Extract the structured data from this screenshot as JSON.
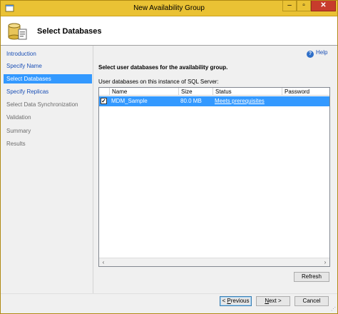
{
  "window": {
    "title": "New Availability Group",
    "min_glyph": "–",
    "max_glyph": "▫",
    "close_glyph": "✕"
  },
  "header": {
    "title": "Select Databases"
  },
  "nav": {
    "items": [
      {
        "label": "Introduction",
        "state": "link"
      },
      {
        "label": "Specify Name",
        "state": "link"
      },
      {
        "label": "Select Databases",
        "state": "active"
      },
      {
        "label": "Specify Replicas",
        "state": "link"
      },
      {
        "label": "Select Data Synchronization",
        "state": "dim"
      },
      {
        "label": "Validation",
        "state": "dim"
      },
      {
        "label": "Summary",
        "state": "dim"
      },
      {
        "label": "Results",
        "state": "dim"
      }
    ]
  },
  "main": {
    "help_label": "Help",
    "instruction": "Select user databases for the availability group.",
    "grid_label": "User databases on this instance of SQL Server:",
    "columns": [
      "Name",
      "Size",
      "Status",
      "Password"
    ],
    "rows": [
      {
        "checked": true,
        "name": "MDM_Sample",
        "size": "80.0 MB",
        "status": "Meets prerequisites",
        "password": ""
      }
    ],
    "refresh_label": "Refresh"
  },
  "footer": {
    "previous_prefix": "< ",
    "previous_key": "P",
    "previous_rest": "revious",
    "next_key": "N",
    "next_rest": "ext >",
    "cancel_label": "Cancel"
  },
  "colors": {
    "selection": "#3399ff",
    "link": "#1a4fb6",
    "titlebar": "#eac234",
    "close": "#c73c2c"
  }
}
